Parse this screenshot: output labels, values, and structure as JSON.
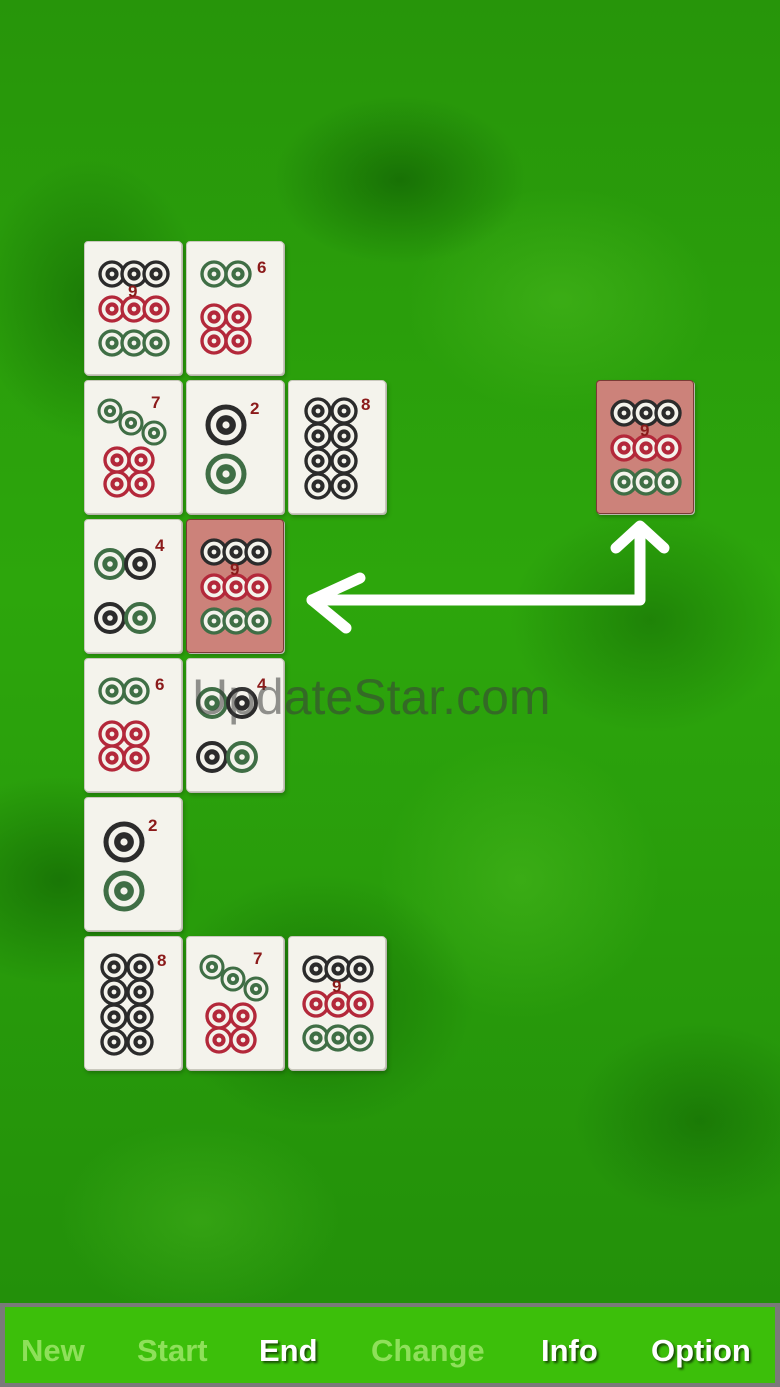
{
  "watermark": "UpdateStar.com",
  "colors": {
    "felt": "#2a9a08",
    "tile_face": "#f4f3ec",
    "tile_selected": "#cc827a",
    "dot_black": "#2b2b2b",
    "dot_red": "#b3283a",
    "dot_green": "#3f6e45",
    "number": "#8b1a1a",
    "toolbar": "#3cbf0a"
  },
  "tiles": [
    {
      "id": "t1",
      "value": 9,
      "label": "9",
      "selected": false
    },
    {
      "id": "t2",
      "value": 6,
      "label": "6",
      "selected": false
    },
    {
      "id": "t3",
      "value": 7,
      "label": "7",
      "selected": false
    },
    {
      "id": "t4",
      "value": 2,
      "label": "2",
      "selected": false
    },
    {
      "id": "t5",
      "value": 8,
      "label": "8",
      "selected": false
    },
    {
      "id": "t6",
      "value": 4,
      "label": "4",
      "selected": false
    },
    {
      "id": "t7",
      "value": 9,
      "label": "9",
      "selected": true
    },
    {
      "id": "t8",
      "value": 6,
      "label": "6",
      "selected": false
    },
    {
      "id": "t9",
      "value": 4,
      "label": "4",
      "selected": false
    },
    {
      "id": "t10",
      "value": 2,
      "label": "2",
      "selected": false
    },
    {
      "id": "t11",
      "value": 8,
      "label": "8",
      "selected": false
    },
    {
      "id": "t12",
      "value": 7,
      "label": "7",
      "selected": false
    },
    {
      "id": "t13",
      "value": 9,
      "label": "9",
      "selected": false
    },
    {
      "id": "t14",
      "value": 9,
      "label": "9",
      "selected": true
    }
  ],
  "hint_arrow": {
    "icon": "swap-arrow-icon",
    "color": "#ffffff"
  },
  "toolbar": {
    "new": {
      "label": "New",
      "enabled": false
    },
    "start": {
      "label": "Start",
      "enabled": false
    },
    "end": {
      "label": "End",
      "enabled": true
    },
    "change": {
      "label": "Change",
      "enabled": false
    },
    "info": {
      "label": "Info",
      "enabled": true
    },
    "option": {
      "label": "Option",
      "enabled": true
    }
  }
}
